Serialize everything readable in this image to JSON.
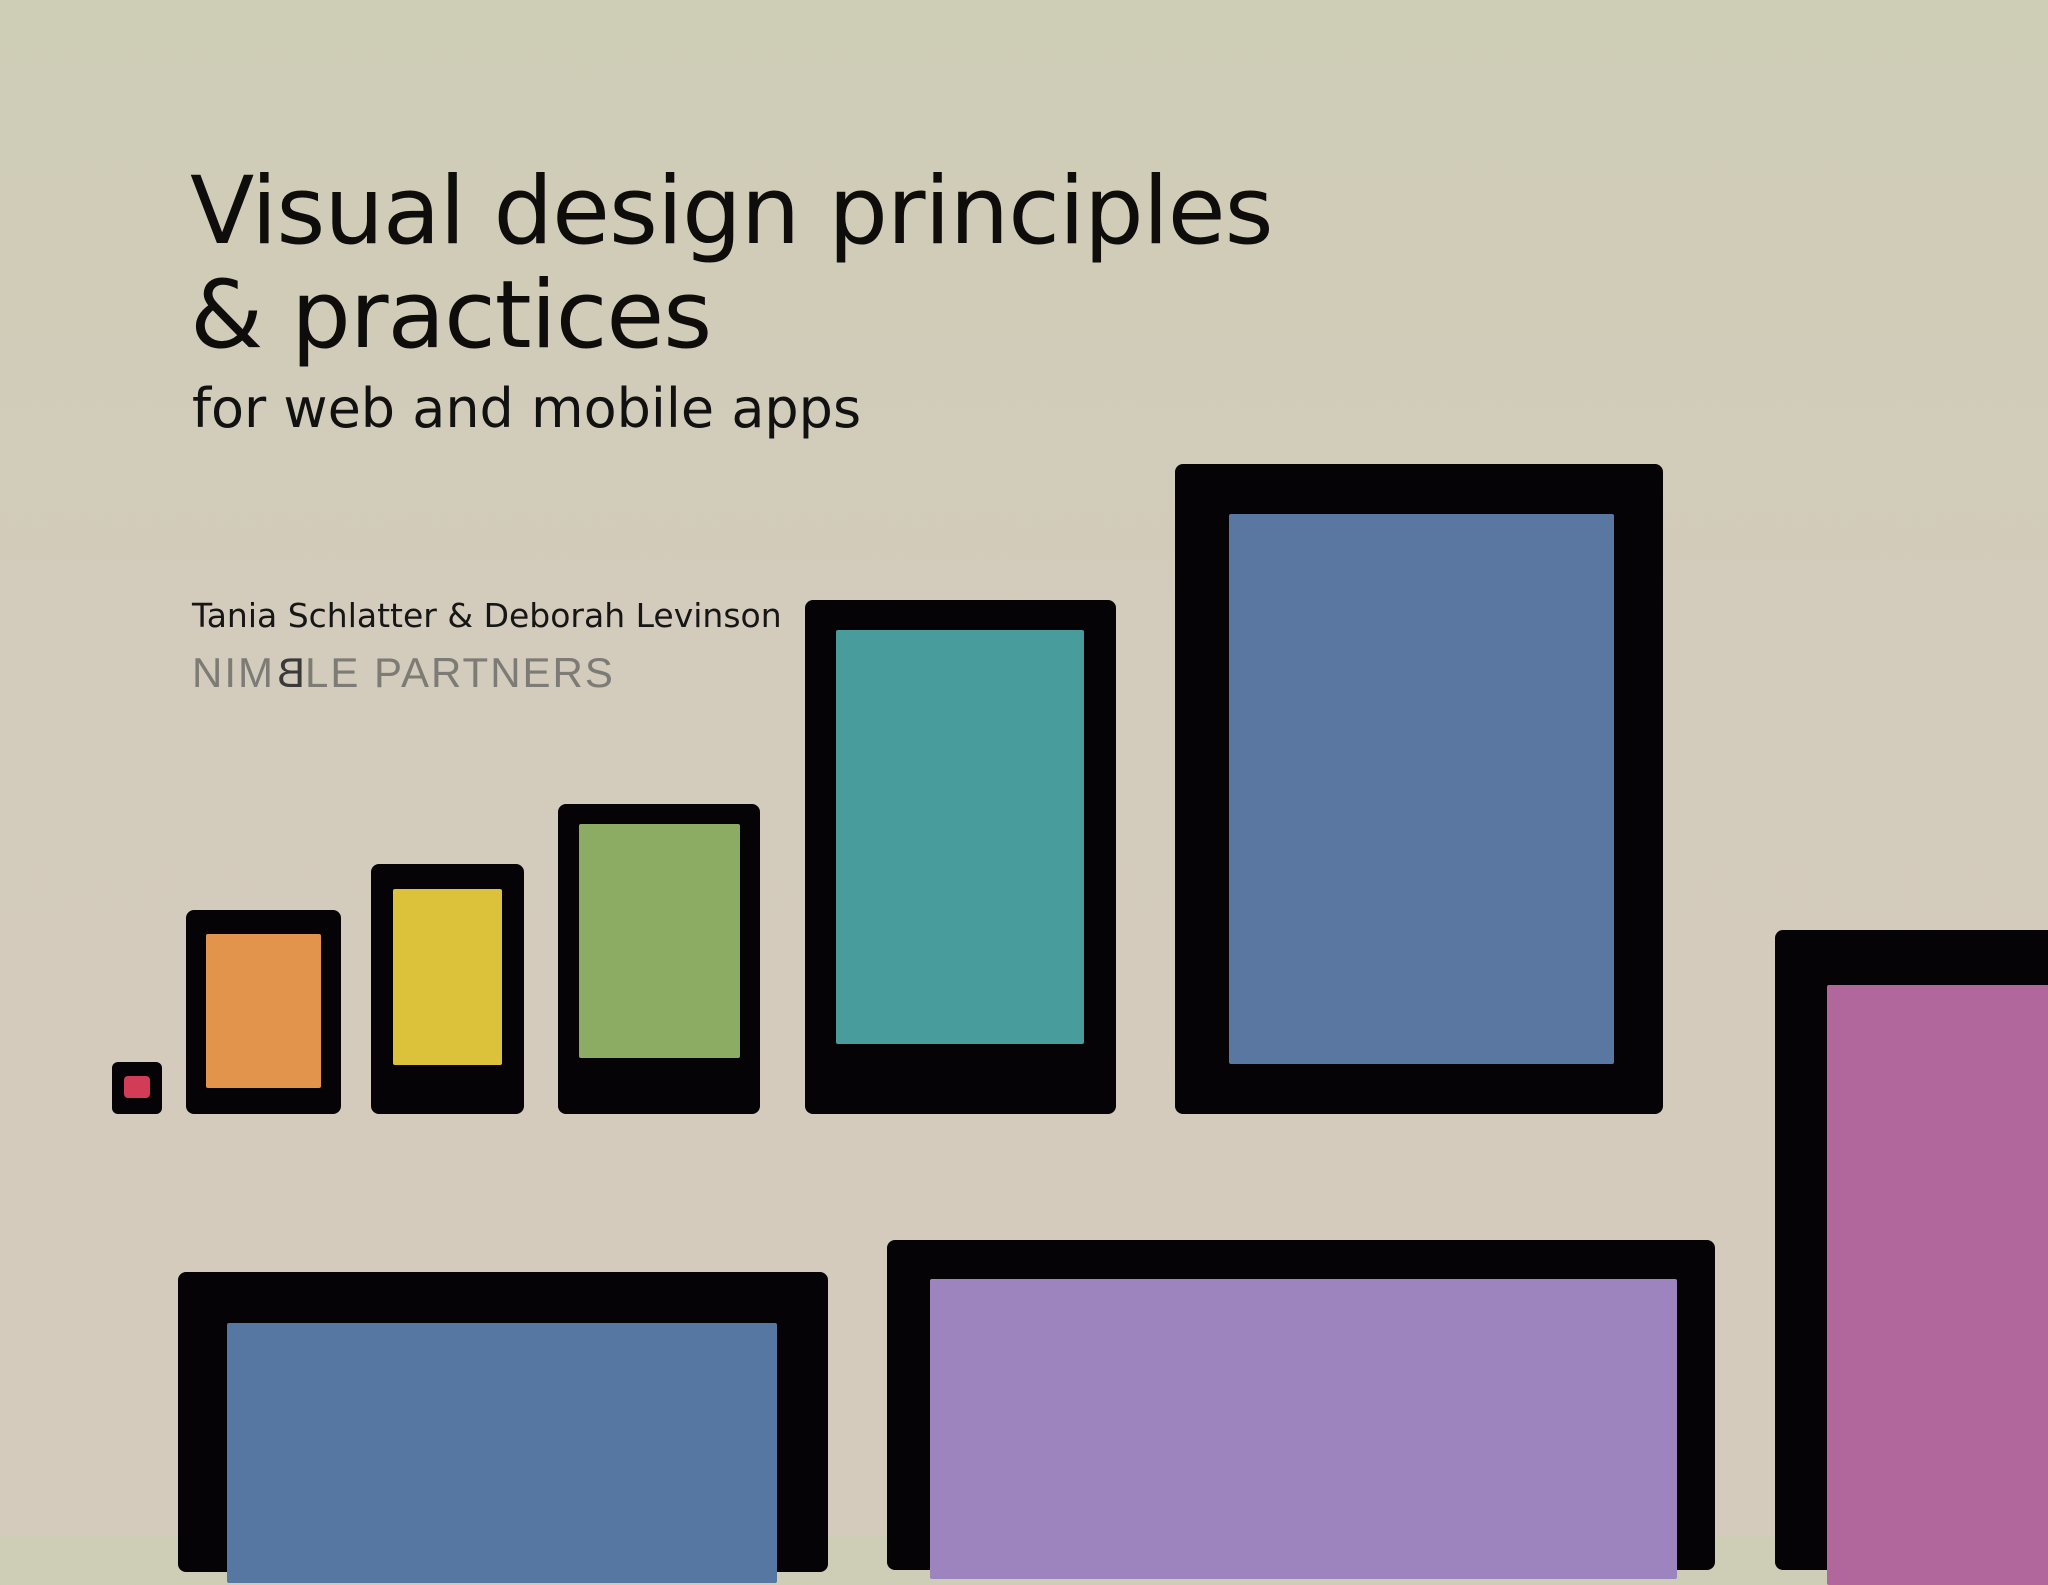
{
  "cover": {
    "title_line1": "Visual design principles",
    "title_line2": "& practices",
    "subtitle": "for web and mobile apps",
    "authors": "Tania Schlatter & Deborah Levinson",
    "brand": {
      "part1": "NIM",
      "mark": "B",
      "part2": "LE PARTNERS"
    }
  },
  "colors": {
    "background": "#d1cbb9",
    "device_frame": "#050305",
    "watch_screen": "#d23c56",
    "small_phone_screen": "#e2944d",
    "phone_screen": "#dcc23b",
    "large_phone_screen": "#8cab63",
    "small_tablet_screen": "#489c9c",
    "tablet_screen": "#5977a0",
    "laptop_screen": "#5677a2",
    "desktop_screen": "#9d84bf",
    "large_display_screen": "#b1679c"
  }
}
